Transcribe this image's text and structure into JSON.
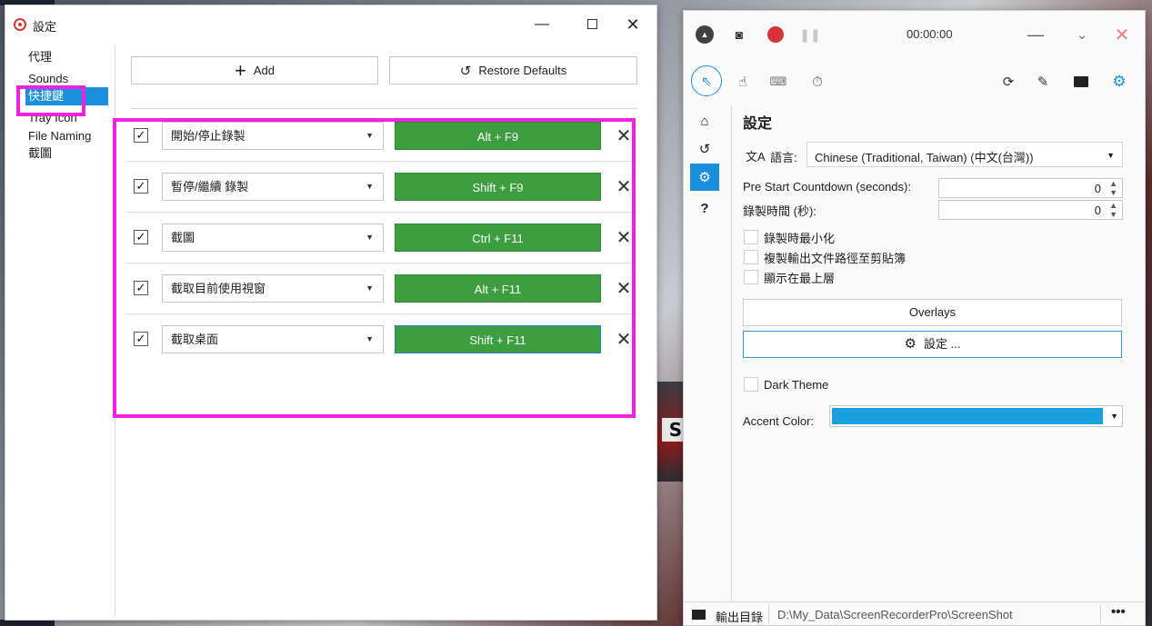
{
  "settings_window": {
    "title": "設定",
    "controls": {
      "minimize": "—",
      "close": "✕"
    },
    "nav": [
      "代理",
      "Sounds",
      "快捷鍵",
      "Tray Icon",
      "File Naming",
      "截圖"
    ],
    "selected_nav": "快捷鍵",
    "add_label": "Add",
    "restore_label": "Restore Defaults",
    "hotkeys": [
      {
        "action": "開始/停止錄製",
        "keys": "Alt + F9",
        "checked": "✓"
      },
      {
        "action": "暫停/繼續 錄製",
        "keys": "Shift + F9",
        "checked": "✓"
      },
      {
        "action": "截圖",
        "keys": "Ctrl + F11",
        "checked": "✓"
      },
      {
        "action": "截取目前使用視窗",
        "keys": "Alt + F11",
        "checked": "✓"
      },
      {
        "action": "截取桌面",
        "keys": "Shift + F11",
        "checked": "✓"
      }
    ],
    "highlight_color": "#ee22e0"
  },
  "recorder_window": {
    "timer": "00:00:00",
    "section_title": "設定",
    "language_label": "語言:",
    "language_value": "Chinese (Traditional, Taiwan) (中文(台灣))",
    "countdown_label": "Pre Start Countdown (seconds):",
    "countdown_value": "0",
    "duration_label": "錄製時間 (秒):",
    "duration_value": "0",
    "checkboxes": [
      "錄製時最小化",
      "複製輸出文件路徑至剪貼簿",
      "顯示在最上層"
    ],
    "overlays_label": "Overlays",
    "settings_button_label": "設定 ...",
    "dark_theme_label": "Dark Theme",
    "accent_label": "Accent Color:",
    "accent_color": "#1c9fdf",
    "output_label": "輸出目錄",
    "output_path": "D:\\My_Data\\ScreenRecorderPro\\ScreenShot",
    "more": "•••"
  }
}
